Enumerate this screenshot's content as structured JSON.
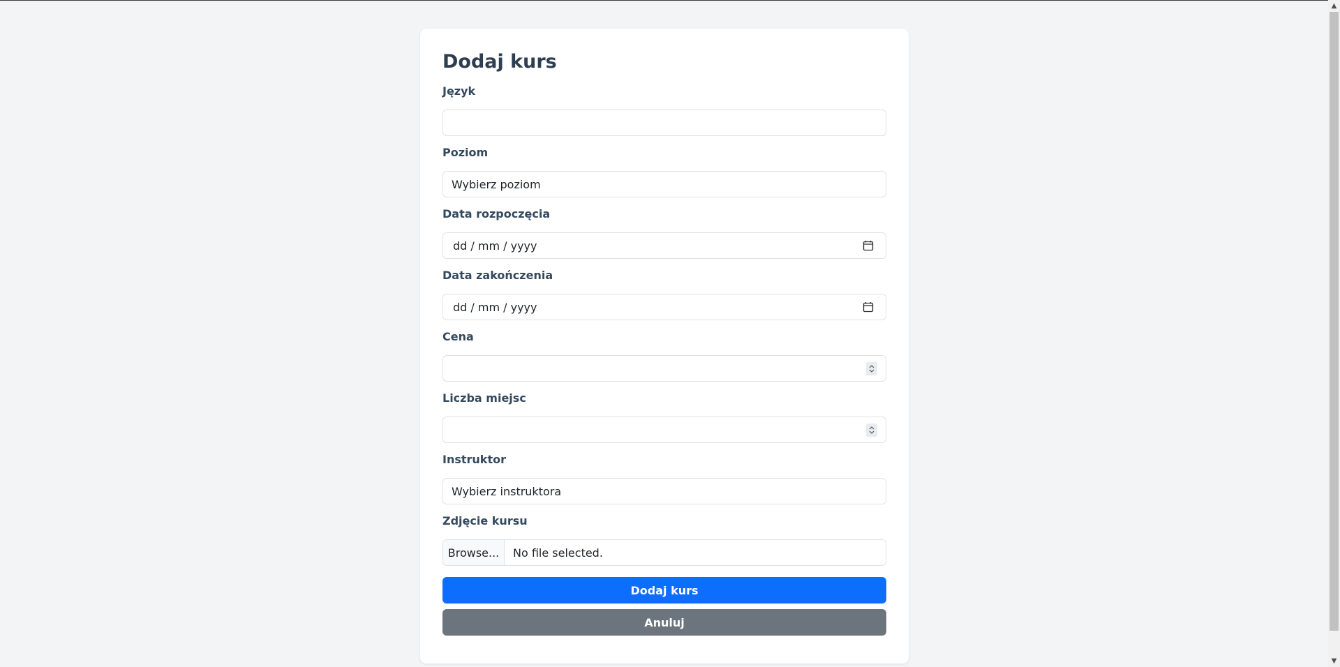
{
  "form": {
    "title": "Dodaj kurs",
    "fields": {
      "language": {
        "label": "Język",
        "value": ""
      },
      "level": {
        "label": "Poziom",
        "value": "Wybierz poziom"
      },
      "start_date": {
        "label": "Data rozpoczęcia",
        "value": "dd / mm / yyyy"
      },
      "end_date": {
        "label": "Data zakończenia",
        "value": "dd / mm / yyyy"
      },
      "price": {
        "label": "Cena",
        "value": ""
      },
      "seats": {
        "label": "Liczba miejsc",
        "value": ""
      },
      "instructor": {
        "label": "Instruktor",
        "value": "Wybierz instruktora"
      },
      "photo": {
        "label": "Zdjęcie kursu",
        "browse_label": "Browse...",
        "status": "No file selected."
      }
    },
    "buttons": {
      "submit_label": "Dodaj kurs",
      "cancel_label": "Anuluj"
    }
  },
  "icons": {
    "date_picker": "calendar-icon",
    "number_spinner": "spinner-icon"
  },
  "colors": {
    "primary": "#0d6efd",
    "secondary": "#6c757d",
    "background": "#f3f4f6",
    "title": "#2c3e50"
  }
}
